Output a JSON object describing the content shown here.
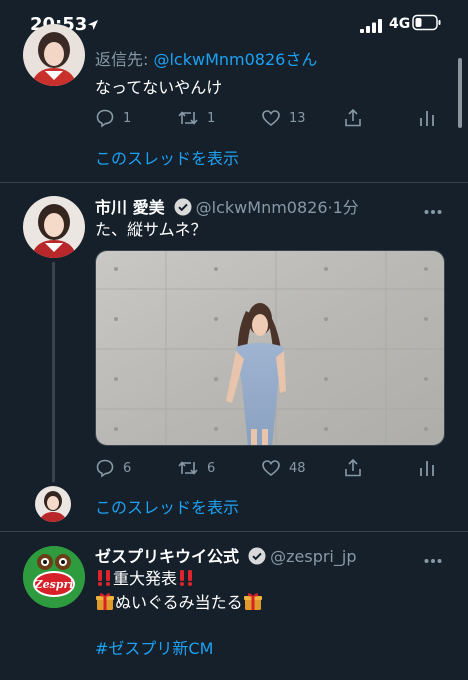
{
  "status_bar": {
    "time": "20:53",
    "network": "4G",
    "icons": [
      "location-arrow-icon",
      "signal-icon",
      "battery-icon"
    ]
  },
  "tweet1": {
    "reply_prefix": "返信先: ",
    "reply_handle": "@lckwMnm0826",
    "reply_suffix": "さん",
    "text": "なってないやんけ",
    "replies": "1",
    "retweets": "1",
    "likes": "13",
    "show_thread": "このスレッドを表示"
  },
  "tweet2": {
    "name": "市川 愛美",
    "handle": "@lckwMnm0826",
    "time": "·1分",
    "text": "た、縦サムネ？",
    "replies": "6",
    "retweets": "6",
    "likes": "48",
    "show_thread": "このスレッドを表示"
  },
  "tweet3": {
    "name": "ゼスプリキウイ公式",
    "handle": "@zespri_jp",
    "line1": "重大発表",
    "line2": "ぬいぐるみ当たる",
    "hashtag": "#ゼスプリ新CM",
    "logo_text": "Zespri"
  },
  "colors": {
    "background": "#15202b",
    "muted": "#8899a6",
    "accent": "#1da1f2",
    "divider": "#38444d"
  }
}
